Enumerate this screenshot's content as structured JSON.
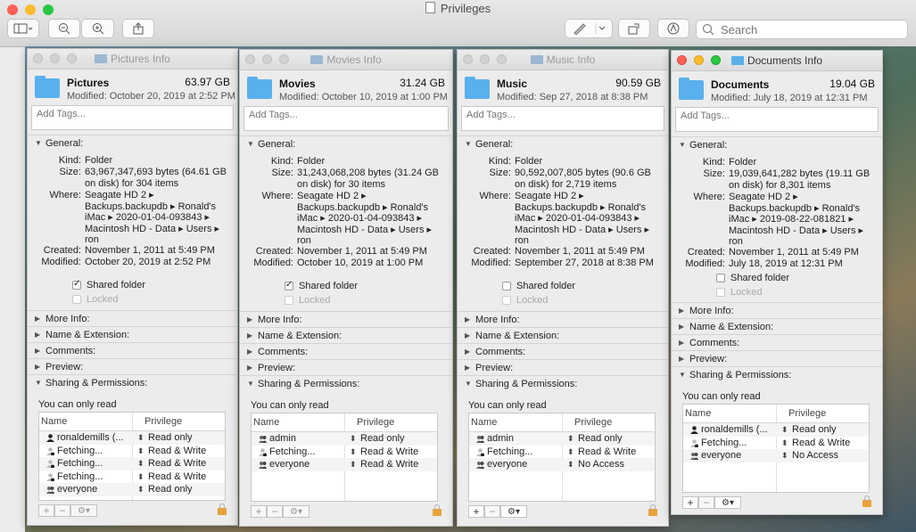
{
  "host": {
    "title": "Privileges",
    "search_placeholder": "Search",
    "toolbar": {
      "sidebar_icon": "sidebar-icon",
      "zoom_out_icon": "zoom-out-icon",
      "zoom_in_icon": "zoom-in-icon",
      "share_icon": "share-icon",
      "markup_icon": "pen-icon",
      "rotate_icon": "rotate-icon",
      "annotate_icon": "markup-circle-icon"
    }
  },
  "windows": [
    {
      "title": "Pictures Info",
      "name": "Pictures",
      "size": "63.97 GB",
      "modified_line": "Modified: October 20, 2019 at 2:52 PM",
      "tags_placeholder": "Add Tags...",
      "general_label": "General:",
      "kind_k": "Kind:",
      "kind_v": "Folder",
      "size_k": "Size:",
      "size_v": "63,967,347,693 bytes (64.61 GB on disk) for 304 items",
      "where_k": "Where:",
      "where_v": "Seagate HD 2 ▸ Backups.backupdb ▸ Ronald's iMac ▸ 2020-01-04-093843 ▸ Macintosh HD - Data ▸ Users ▸ ron",
      "created_k": "Created:",
      "created_v": "November 1, 2011 at 5:49 PM",
      "modified_k": "Modified:",
      "modified_v": "October 20, 2019 at 2:52 PM",
      "shared_label": "Shared folder",
      "shared_checked": true,
      "locked_label": "Locked",
      "sections": [
        "More Info:",
        "Name & Extension:",
        "Comments:",
        "Preview:"
      ],
      "sharing_label": "Sharing & Permissions:",
      "readonly_text": "You can only read",
      "col_name": "Name",
      "col_priv": "Privilege",
      "rows": [
        {
          "name": "ronaldemills (...",
          "priv": "Read only",
          "icon": "user"
        },
        {
          "name": "Fetching...",
          "priv": "Read & Write",
          "icon": "fetch"
        },
        {
          "name": "Fetching...",
          "priv": "Read & Write",
          "icon": "fetch"
        },
        {
          "name": "Fetching...",
          "priv": "Read & Write",
          "icon": "fetch"
        },
        {
          "name": "everyone",
          "priv": "Read only",
          "icon": "group"
        }
      ]
    },
    {
      "title": "Movies Info",
      "name": "Movies",
      "size": "31.24 GB",
      "modified_line": "Modified: October 10, 2019 at 1:00 PM",
      "tags_placeholder": "Add Tags...",
      "general_label": "General:",
      "kind_k": "Kind:",
      "kind_v": "Folder",
      "size_k": "Size:",
      "size_v": "31,243,068,208 bytes (31.24 GB on disk) for 30 items",
      "where_k": "Where:",
      "where_v": "Seagate HD 2 ▸ Backups.backupdb ▸ Ronald's iMac ▸ 2020-01-04-093843 ▸ Macintosh HD - Data ▸ Users ▸ ron",
      "created_k": "Created:",
      "created_v": "November 1, 2011 at 5:49 PM",
      "modified_k": "Modified:",
      "modified_v": "October 10, 2019 at 1:00 PM",
      "shared_label": "Shared folder",
      "shared_checked": true,
      "locked_label": "Locked",
      "sections": [
        "More Info:",
        "Name & Extension:",
        "Comments:",
        "Preview:"
      ],
      "sharing_label": "Sharing & Permissions:",
      "readonly_text": "You can only read",
      "col_name": "Name",
      "col_priv": "Privilege",
      "rows": [
        {
          "name": "admin",
          "priv": "Read only",
          "icon": "group"
        },
        {
          "name": "Fetching...",
          "priv": "Read & Write",
          "icon": "fetch"
        },
        {
          "name": "everyone",
          "priv": "Read & Write",
          "icon": "group"
        }
      ]
    },
    {
      "title": "Music Info",
      "name": "Music",
      "size": "90.59 GB",
      "modified_line": "Modified: Sep 27, 2018 at 8:38 PM",
      "tags_placeholder": "Add Tags...",
      "general_label": "General:",
      "kind_k": "Kind:",
      "kind_v": "Folder",
      "size_k": "Size:",
      "size_v": "90,592,007,805 bytes (90.6 GB on disk) for 2,719 items",
      "where_k": "Where:",
      "where_v": "Seagate HD 2 ▸ Backups.backupdb ▸ Ronald's iMac ▸ 2020-01-04-093843 ▸ Macintosh HD - Data ▸ Users ▸ ron",
      "created_k": "Created:",
      "created_v": "November 1, 2011 at 5:49 PM",
      "modified_k": "Modified:",
      "modified_v": "September 27, 2018 at 8:38 PM",
      "shared_label": "Shared folder",
      "shared_checked": false,
      "locked_label": "Locked",
      "sections": [
        "More Info:",
        "Name & Extension:",
        "Comments:",
        "Preview:"
      ],
      "sharing_label": "Sharing & Permissions:",
      "readonly_text": "You can only read",
      "col_name": "Name",
      "col_priv": "Privilege",
      "rows": [
        {
          "name": "admin",
          "priv": "Read only",
          "icon": "group"
        },
        {
          "name": "Fetching...",
          "priv": "Read & Write",
          "icon": "fetch"
        },
        {
          "name": "everyone",
          "priv": "No Access",
          "icon": "group"
        }
      ]
    },
    {
      "title": "Documents Info",
      "name": "Documents",
      "size": "19.04 GB",
      "modified_line": "Modified: July 18, 2019 at 12:31 PM",
      "tags_placeholder": "Add Tags...",
      "general_label": "General:",
      "kind_k": "Kind:",
      "kind_v": "Folder",
      "size_k": "Size:",
      "size_v": "19,039,641,282 bytes (19.11 GB on disk) for 8,301 items",
      "where_k": "Where:",
      "where_v": "Seagate HD 2 ▸ Backups.backupdb ▸ Ronald's iMac ▸ 2019-08-22-081821 ▸ Macintosh HD - Data ▸ Users ▸ ron",
      "created_k": "Created:",
      "created_v": "November 1, 2011 at 5:49 PM",
      "modified_k": "Modified:",
      "modified_v": "July 18, 2019 at 12:31 PM",
      "shared_label": "Shared folder",
      "shared_checked": false,
      "locked_label": "Locked",
      "sections": [
        "More Info:",
        "Name & Extension:",
        "Comments:",
        "Preview:"
      ],
      "sharing_label": "Sharing & Permissions:",
      "readonly_text": "You can only read",
      "col_name": "Name",
      "col_priv": "Privilege",
      "rows": [
        {
          "name": "ronaldemills (...",
          "priv": "Read only",
          "icon": "user"
        },
        {
          "name": "Fetching...",
          "priv": "Read & Write",
          "icon": "fetch"
        },
        {
          "name": "everyone",
          "priv": "No Access",
          "icon": "group"
        }
      ]
    }
  ]
}
